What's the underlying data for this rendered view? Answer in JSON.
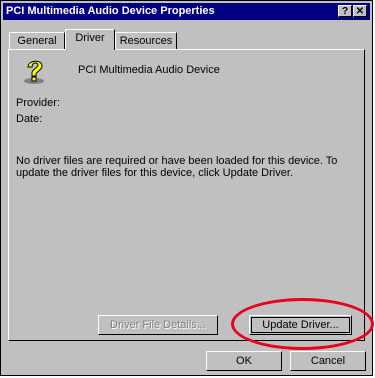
{
  "window": {
    "title": "PCI Multimedia Audio Device Properties",
    "help_label": "?",
    "close_label": "✕"
  },
  "tabs": [
    {
      "label": "General"
    },
    {
      "label": "Driver"
    },
    {
      "label": "Resources"
    }
  ],
  "device": {
    "icon": "unknown-device-question-icon",
    "name": "PCI Multimedia Audio Device"
  },
  "fields": {
    "provider_label": "Provider:",
    "date_label": "Date:"
  },
  "message": {
    "line1": "No driver files are required or have been loaded for this device.  To",
    "line2": "update the driver files for this device, click Update Driver."
  },
  "buttons": {
    "driver_file_details": "Driver File Details...",
    "update_driver": "Update Driver...",
    "ok": "OK",
    "cancel": "Cancel"
  },
  "highlight": {
    "color": "#e8001c"
  }
}
